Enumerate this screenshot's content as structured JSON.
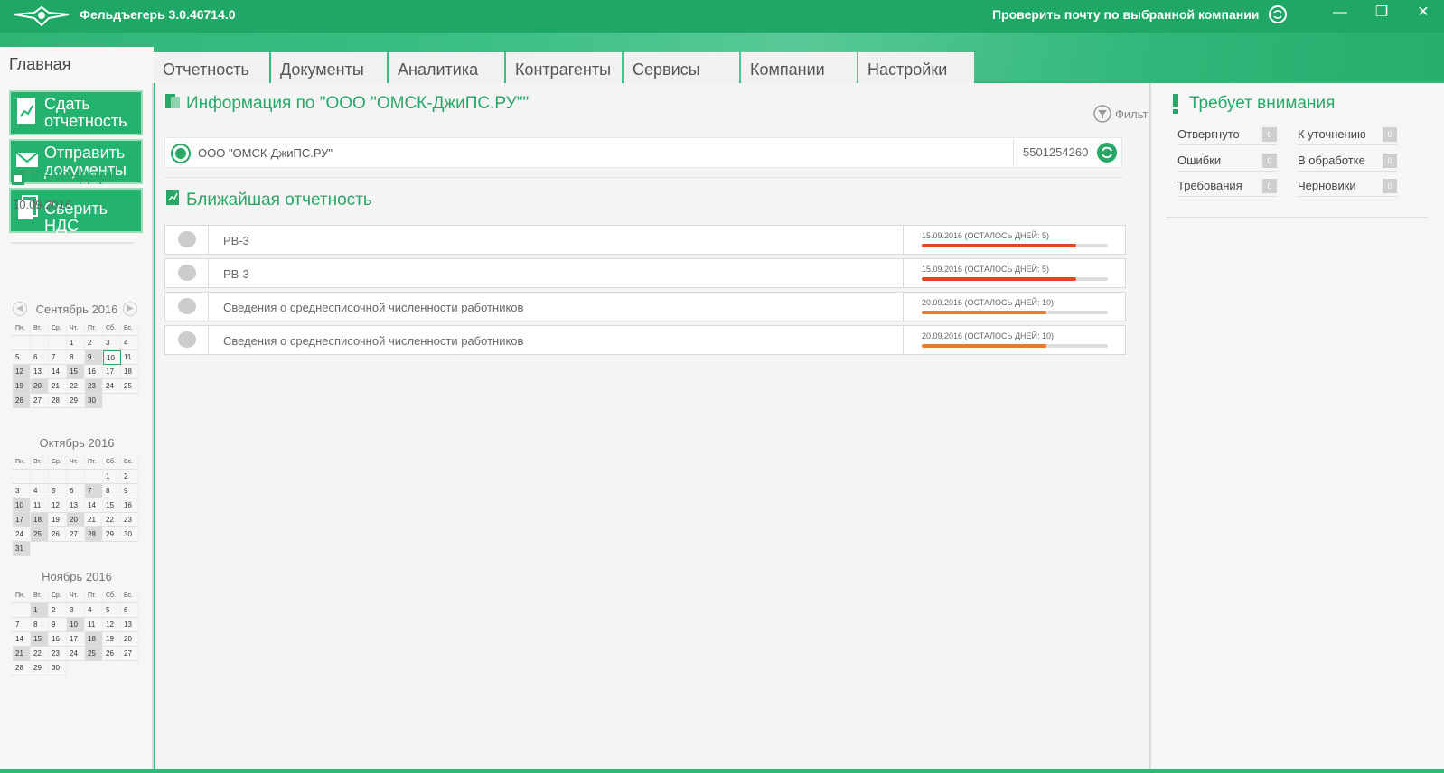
{
  "app": {
    "title": "Фельдъегерь 3.0.46714.0",
    "check_mail_label": "Проверить почту по выбранной компании"
  },
  "window_controls": {
    "minimize": "—",
    "restore": "❐",
    "close": "✕"
  },
  "nav": {
    "home_label": "Главная",
    "tabs": [
      {
        "label": "Отчетность"
      },
      {
        "label": "Документы"
      },
      {
        "label": "Аналитика"
      },
      {
        "label": "Контрагенты"
      },
      {
        "label": "Сервисы"
      },
      {
        "label": "Компании"
      },
      {
        "label": "Настройки"
      }
    ]
  },
  "sidebar": {
    "actions": [
      {
        "label_line1": "Сдать",
        "label_line2": "отчетность"
      },
      {
        "label_line1": "Отправить",
        "label_line2": "документы"
      },
      {
        "label_line1": "Сверить НДС",
        "label_line2": ""
      }
    ],
    "calendar": {
      "title": "Календарь",
      "current_date": "10.09.2016",
      "weekdays": [
        "Пн.",
        "Вт.",
        "Ср.",
        "Чт.",
        "Пт.",
        "Сб.",
        "Вс."
      ],
      "months": [
        {
          "name": "Сентябрь 2016",
          "offset": 3,
          "days": 30,
          "weekend": [
            9,
            12,
            15,
            19,
            20,
            23,
            26,
            30
          ],
          "today": 10
        },
        {
          "name": "Октябрь 2016",
          "offset": 5,
          "days": 31,
          "weekend": [
            7,
            10,
            17,
            18,
            20,
            25,
            28,
            31
          ],
          "today": 0
        },
        {
          "name": "Ноябрь 2016",
          "offset": 1,
          "days": 30,
          "weekend": [
            1,
            10,
            15,
            18,
            21,
            25
          ],
          "today": 0
        }
      ]
    }
  },
  "main": {
    "info_title": "Информация по \"ООО \"ОМСК-ДжиПС.РУ\"\"",
    "filter_label": "Фильтр",
    "company": {
      "name": "ООО \"ОМСК-ДжиПС.РУ\"",
      "inn": "5501254260"
    },
    "nearest_title": "Ближайшая отчетность",
    "reports": [
      {
        "name": "РВ-3",
        "deadline": "15.09.2016 (ОСТАЛОСЬ ДНЕЙ: 5)",
        "progress": 0.83,
        "color": "#e0451f"
      },
      {
        "name": "РВ-3",
        "deadline": "15.09.2016 (ОСТАЛОСЬ ДНЕЙ: 5)",
        "progress": 0.83,
        "color": "#e0451f"
      },
      {
        "name": "Сведения о среднесписочной численности работников",
        "deadline": "20.09.2016 (ОСТАЛОСЬ ДНЕЙ: 10)",
        "progress": 0.67,
        "color": "#e97a2b"
      },
      {
        "name": "Сведения о среднесписочной численности работников",
        "deadline": "20.09.2016 (ОСТАЛОСЬ ДНЕЙ: 10)",
        "progress": 0.67,
        "color": "#e97a2b"
      }
    ]
  },
  "attention": {
    "title": "Требует внимания",
    "items": [
      {
        "label": "Отвергнуто",
        "count": "0"
      },
      {
        "label": "К уточнению",
        "count": "0"
      },
      {
        "label": "Ошибки",
        "count": "0"
      },
      {
        "label": "В обработке",
        "count": "0"
      },
      {
        "label": "Требования",
        "count": "0"
      },
      {
        "label": "Черновики",
        "count": "0"
      }
    ]
  },
  "colors": {
    "brand": "#1fa865",
    "accent": "#27a866",
    "urgent": "#e0451f",
    "warning": "#e97a2b"
  }
}
